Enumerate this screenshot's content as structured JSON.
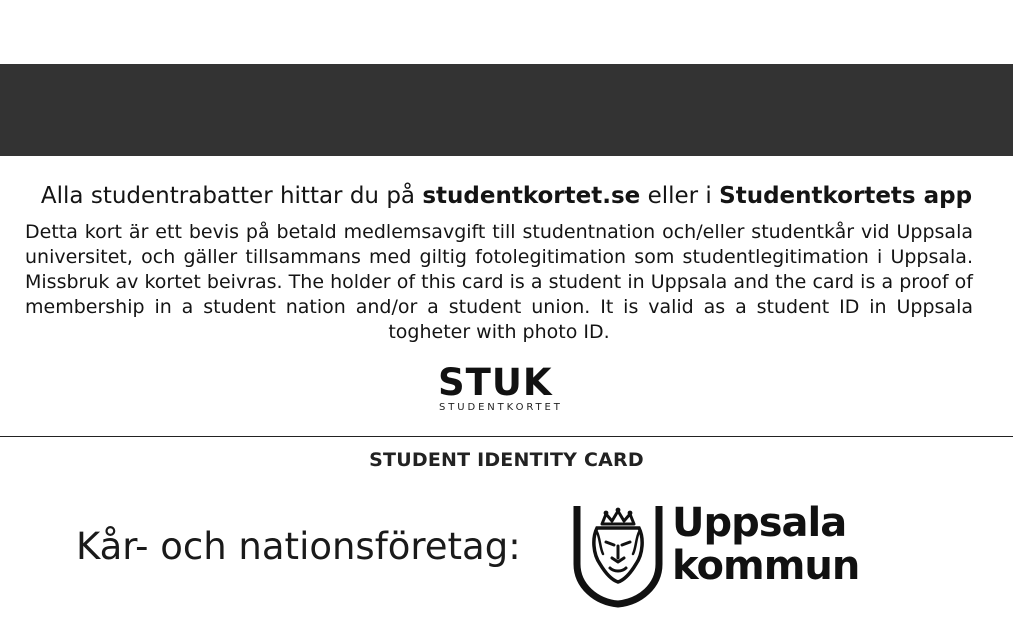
{
  "colors": {
    "magnetic_stripe": "#333333",
    "text": "#141414",
    "background": "#ffffff"
  },
  "headline": {
    "prefix": "Alla studentrabatter hittar du på ",
    "site": "studentkortet.se",
    "middle": " eller i ",
    "app": "Studentkortets app"
  },
  "body_text": "Detta kort är ett bevis på betald medlemsavgift till studentnation och/eller studentkår vid Uppsala universitet, och gäller tillsammans med giltig fotolegitimation som studentlegitimation i Uppsala. Missbruk av kortet beivras. The holder of this card is a student in Uppsala and the card is a proof of membership in a student nation and/or a student union. It is valid as a student ID in Uppsala togheter with photo ID.",
  "stuk_logo": {
    "word": "STUK",
    "subtitle": "STUDENTKORTET"
  },
  "card_type": "STUDENT IDENTITY CARD",
  "sponsor_label": "Kår- och nationsföretag:",
  "sponsor_logo": {
    "icon": "lion-crown-shield-icon",
    "line1": "Uppsala",
    "line2": "kommun"
  }
}
